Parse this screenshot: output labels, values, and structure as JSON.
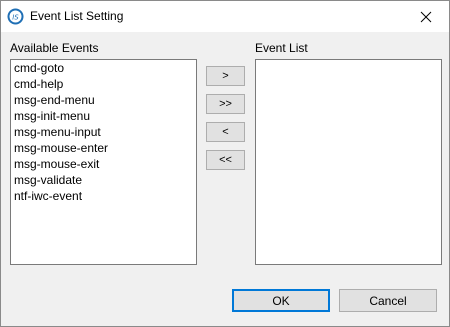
{
  "window": {
    "title": "Event List Setting"
  },
  "available": {
    "label": "Available Events",
    "items": [
      "cmd-goto",
      "cmd-help",
      "msg-end-menu",
      "msg-init-menu",
      "msg-menu-input",
      "msg-mouse-enter",
      "msg-mouse-exit",
      "msg-validate",
      "ntf-iwc-event"
    ]
  },
  "event_list": {
    "label": "Event List",
    "items": []
  },
  "transfer": {
    "add_label": ">",
    "add_all_label": ">>",
    "remove_label": "<",
    "remove_all_label": "<<"
  },
  "dialog": {
    "ok_label": "OK",
    "cancel_label": "Cancel"
  },
  "colors": {
    "accent": "#0078d7",
    "button_face": "#e1e1e1",
    "window_bg": "#f0f0f0"
  }
}
